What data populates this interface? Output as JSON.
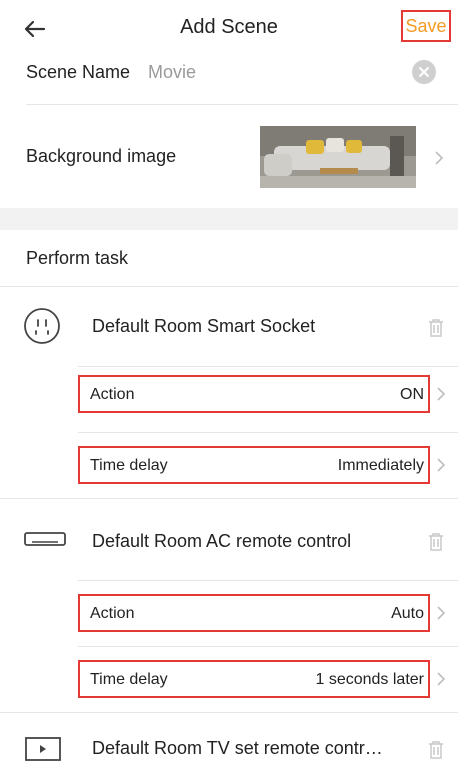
{
  "header": {
    "title": "Add Scene",
    "save_label": "Save"
  },
  "scene_name": {
    "label": "Scene Name",
    "value": "Movie"
  },
  "background": {
    "label": "Background image"
  },
  "tasks": {
    "section_label": "Perform task",
    "devices": [
      {
        "name": "Default Room Smart Socket",
        "icon": "socket-icon",
        "action": {
          "label": "Action",
          "value": "ON"
        },
        "delay": {
          "label": "Time delay",
          "value": "Immediately"
        }
      },
      {
        "name": "Default Room AC remote control",
        "icon": "ac-icon",
        "action": {
          "label": "Action",
          "value": "Auto"
        },
        "delay": {
          "label": "Time delay",
          "value": "1 seconds later"
        }
      },
      {
        "name": "Default Room TV set remote contr…",
        "icon": "tv-icon"
      }
    ]
  },
  "colors": {
    "accent": "#f59a23",
    "highlight": "#e53935"
  }
}
